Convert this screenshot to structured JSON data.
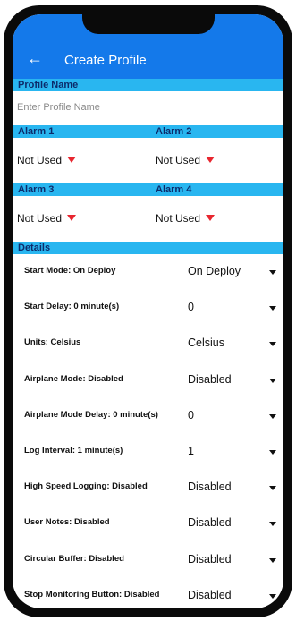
{
  "header": {
    "back_icon": "arrow-left-icon",
    "title": "Create Profile"
  },
  "profile_name": {
    "section_label": "Profile Name",
    "placeholder": "Enter Profile Name"
  },
  "alarms_row1": {
    "left": {
      "label": "Alarm 1",
      "value": "Not Used"
    },
    "right": {
      "label": "Alarm 2",
      "value": "Not Used"
    }
  },
  "alarms_row2": {
    "left": {
      "label": "Alarm 3",
      "value": "Not Used"
    },
    "right": {
      "label": "Alarm 4",
      "value": "Not Used"
    }
  },
  "details": {
    "section_label": "Details",
    "rows": [
      {
        "label": "Start Mode: On Deploy",
        "value": "On Deploy"
      },
      {
        "label": "Start Delay: 0 minute(s)",
        "value": "0"
      },
      {
        "label": "Units: Celsius",
        "value": "Celsius"
      },
      {
        "label": "Airplane Mode: Disabled",
        "value": "Disabled"
      },
      {
        "label": "Airplane Mode Delay: 0 minute(s)",
        "value": "0"
      },
      {
        "label": "Log Interval: 1 minute(s)",
        "value": "1"
      },
      {
        "label": "High Speed Logging: Disabled",
        "value": "Disabled"
      },
      {
        "label": "User Notes: Disabled",
        "value": "Disabled"
      },
      {
        "label": "Circular Buffer: Disabled",
        "value": "Disabled"
      },
      {
        "label": "Stop Monitoring Button: Disabled",
        "value": "Disabled"
      }
    ]
  },
  "colors": {
    "header": "#1479ea",
    "section": "#29b6f0",
    "section_text": "#0c2b6b",
    "alarm_arrow": "#e8262f"
  }
}
